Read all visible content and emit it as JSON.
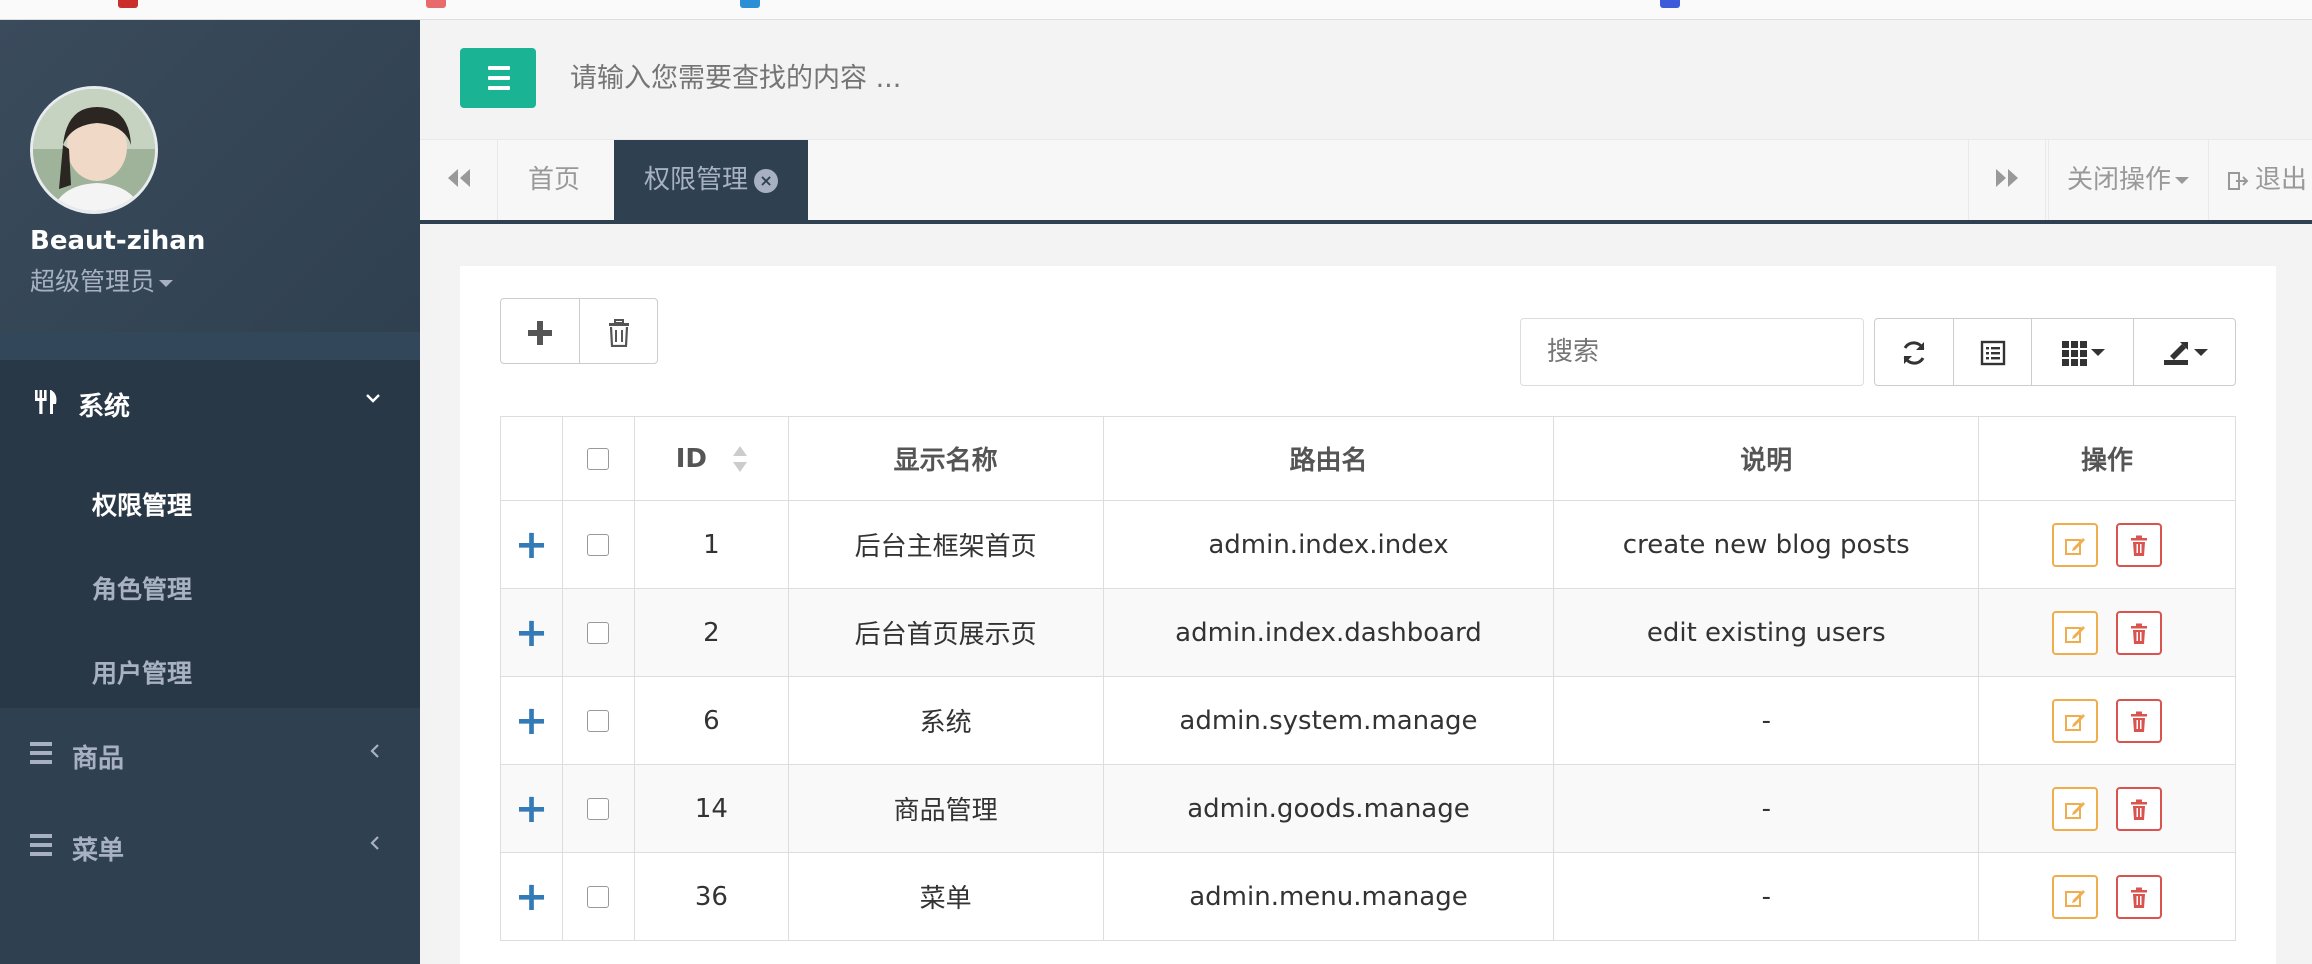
{
  "profile": {
    "name": "Beaut-zihan",
    "role": "超级管理员"
  },
  "sidebar": {
    "group": {
      "label": "系统",
      "items": [
        {
          "label": "权限管理"
        },
        {
          "label": "角色管理"
        },
        {
          "label": "用户管理"
        }
      ]
    },
    "items": [
      {
        "label": "商品"
      },
      {
        "label": "菜单"
      }
    ]
  },
  "topbar": {
    "search_placeholder": "请输入您需要查找的内容 ..."
  },
  "tabs": {
    "items": [
      {
        "label": "首页"
      },
      {
        "label": "权限管理"
      }
    ],
    "close_ops": "关闭操作",
    "logout": "退出"
  },
  "table": {
    "search_placeholder": "搜索",
    "columns": [
      "ID",
      "显示名称",
      "路由名",
      "说明",
      "操作"
    ],
    "rows": [
      {
        "id": "1",
        "name": "后台主框架首页",
        "route": "admin.index.index",
        "desc": "create new blog posts"
      },
      {
        "id": "2",
        "name": "后台首页展示页",
        "route": "admin.index.dashboard",
        "desc": "edit existing users"
      },
      {
        "id": "6",
        "name": "系统",
        "route": "admin.system.manage",
        "desc": "-"
      },
      {
        "id": "14",
        "name": "商品管理",
        "route": "admin.goods.manage",
        "desc": "-"
      },
      {
        "id": "36",
        "name": "菜单",
        "route": "admin.menu.manage",
        "desc": "-"
      }
    ]
  },
  "colors": {
    "sidebar_bg": "#2f4050",
    "accent": "#1ab394",
    "edit": "#f0ad4e",
    "delete": "#d9534f",
    "expand": "#337ab7"
  }
}
